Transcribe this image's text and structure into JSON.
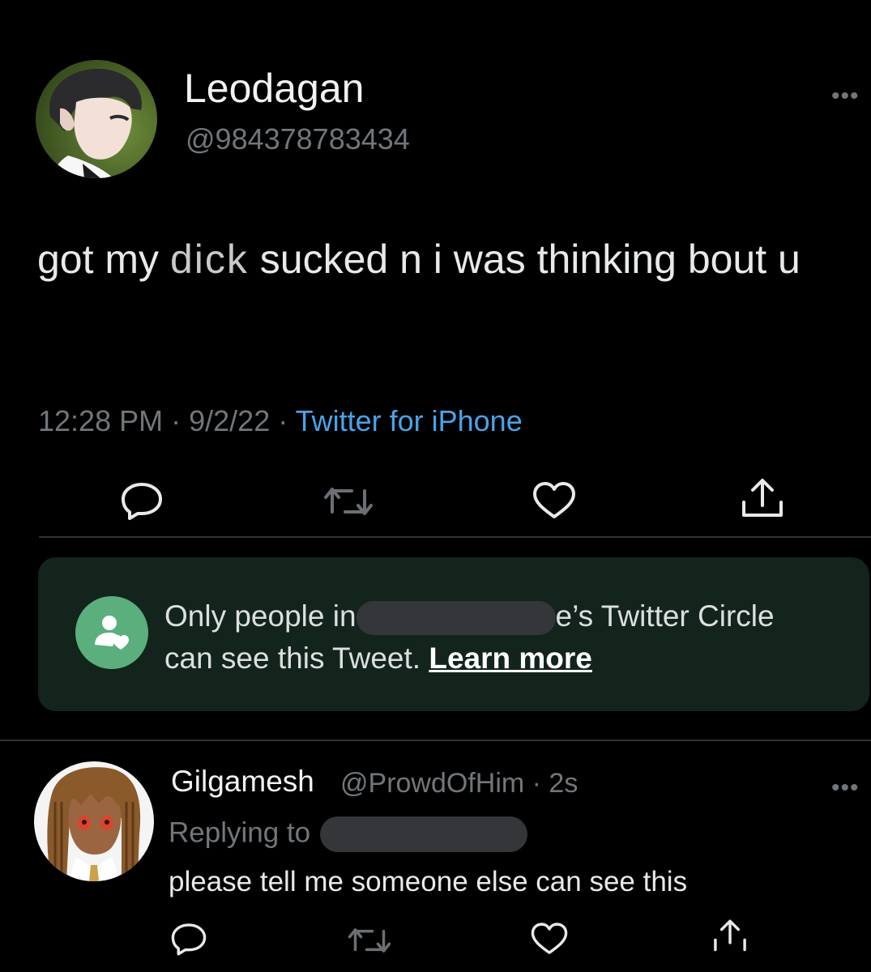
{
  "tweet": {
    "author_name": "Leodagan",
    "author_handle": "@984378783434",
    "text_part1": "got my ",
    "text_censored": "dick",
    "text_part2": " sucked n i was thinking bout u",
    "time": "12:28 PM",
    "date": "9/2/22",
    "source": "Twitter for iPhone",
    "separator": "·"
  },
  "circle_notice": {
    "text_before": "Only people in",
    "text_after": "e’s Twitter Circle",
    "text_line2": "can see this Tweet.",
    "learn_more": "Learn more"
  },
  "reply": {
    "author_name": "Gilgamesh",
    "author_handle_time": "@ProwdOfHim · 2s",
    "replying_to": "Replying to",
    "text": "please tell me someone else can see this"
  },
  "icons": [
    "more-icon",
    "reply-icon",
    "retweet-icon",
    "like-icon",
    "share-icon",
    "circle-people-icon"
  ],
  "colors": {
    "background": "#000000",
    "link": "#4aa3e8",
    "muted": "#71767b",
    "circle_box": "#13241c",
    "circle_icon": "#5aaf7c"
  }
}
